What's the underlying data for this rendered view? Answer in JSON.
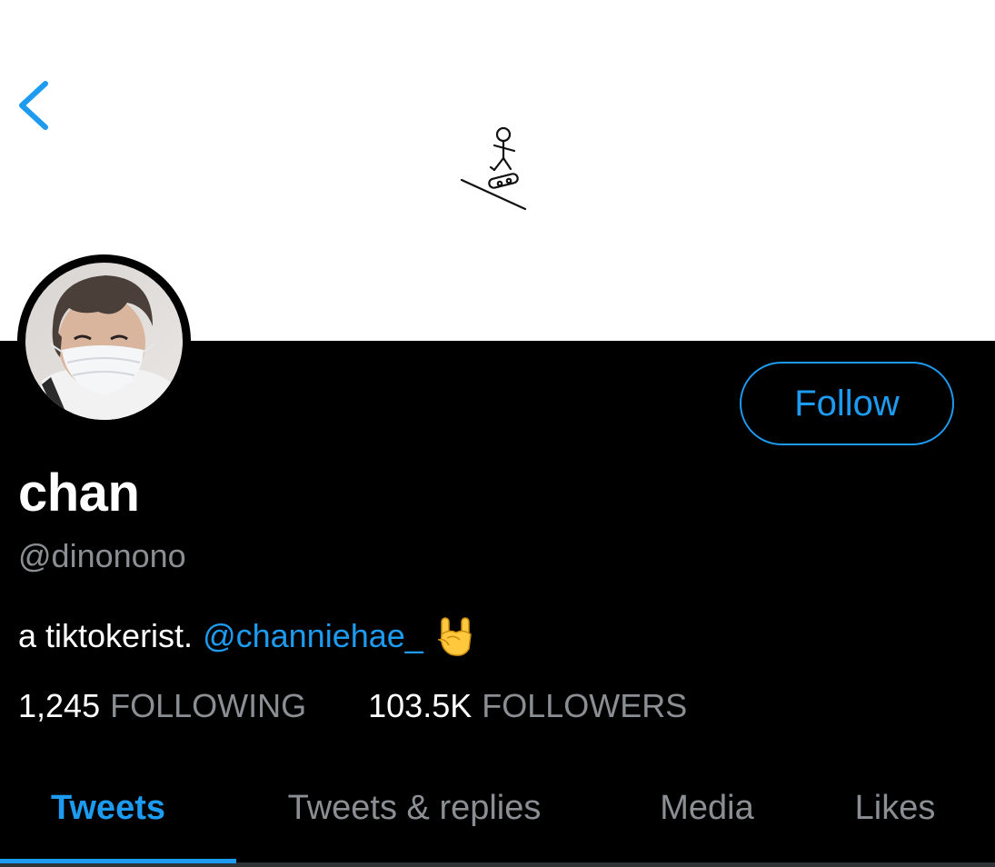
{
  "profile": {
    "display_name": "chan",
    "handle": "@dinonono",
    "bio_text": "a tiktokerist.",
    "bio_mention": "@channiehae_",
    "bio_emoji": "sign-of-the-horns-emoji",
    "avatar": "profile-photo-masked-person"
  },
  "header": {
    "back_icon": "chevron-left-icon",
    "banner_art": "stick-figure-skateboarder-drawing"
  },
  "actions": {
    "follow_label": "Follow"
  },
  "stats": {
    "following_count": "1,245",
    "following_label": "FOLLOWING",
    "followers_count": "103.5K",
    "followers_label": "FOLLOWERS"
  },
  "tabs": [
    {
      "label": "Tweets",
      "active": true
    },
    {
      "label": "Tweets & replies",
      "active": false
    },
    {
      "label": "Media",
      "active": false
    },
    {
      "label": "Likes",
      "active": false
    }
  ],
  "colors": {
    "accent": "#1d9bf0",
    "background": "#000000",
    "banner": "#ffffff",
    "secondary_text": "#8b8f94",
    "primary_text": "#ffffff"
  }
}
